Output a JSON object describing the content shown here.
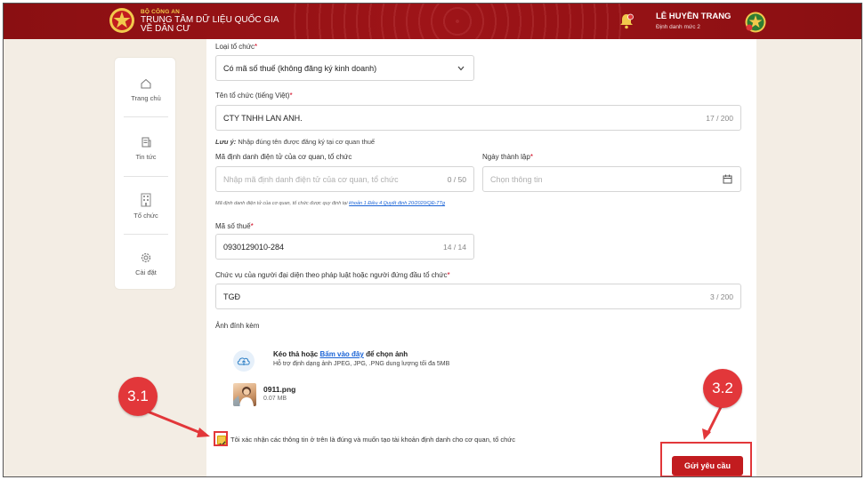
{
  "header": {
    "agency": "BỘ CÔNG AN",
    "center_line1": "TRUNG TÂM DỮ LIỆU QUỐC GIA",
    "center_line2": "VỀ DÂN CƯ",
    "user_name": "LÊ HUYỀN TRANG",
    "user_level": "Định danh mức 2"
  },
  "sidebar": {
    "items": [
      {
        "label": "Trang chủ",
        "icon": "home-icon"
      },
      {
        "label": "Tin tức",
        "icon": "news-icon"
      },
      {
        "label": "Tổ chức",
        "icon": "building-icon"
      },
      {
        "label": "Cài đặt",
        "icon": "gear-icon"
      }
    ]
  },
  "form": {
    "org_type_label": "Loại tổ chức",
    "org_type_value": "Có mã số thuế (không đăng ký kinh doanh)",
    "org_name_label": "Tên tổ chức (tiếng Việt)",
    "org_name_value": "CTY TNHH LAN ANH.",
    "org_name_count": "17 / 200",
    "note_prefix": "Lưu ý:",
    "note_text": "Nhập đúng tên được đăng ký tại cơ quan thuế",
    "eid_label": "Mã định danh điện tử của cơ quan, tổ chức",
    "eid_placeholder": "Nhập mã định danh điện tử của cơ quan, tổ chức",
    "eid_count": "0 / 50",
    "founded_label": "Ngày thành lập",
    "founded_placeholder": "Chọn thông tin",
    "eid_hint": "Mã định danh điện tử của cơ quan, tổ chức được quy định tại",
    "eid_hint_link": "khoản 1 Điều 4 Quyết định 20/2020/QĐ-TTg",
    "tax_label": "Mã số thuế",
    "tax_value": "0930129010-284",
    "tax_count": "14 / 14",
    "position_label": "Chức vụ của người đại diện theo pháp luật hoặc người đứng đầu tổ chức",
    "position_value": "TGĐ",
    "position_count": "3 / 200",
    "attach_label": "Ảnh đính kèm",
    "upload_prefix": "Kéo thả hoặc",
    "upload_link": "Bấm vào đây",
    "upload_suffix": "để chọn ảnh",
    "upload_sub": "Hỗ trợ định dạng ảnh JPEG, JPG, .PNG dung lượng tối đa 5MB",
    "file_name": "0911.png",
    "file_size": "0.07 MB",
    "confirm_text": "Tôi xác nhận các thông tin ở trên là đúng và muốn tạo tài khoản định danh cho cơ quan, tổ chức",
    "submit_label": "Gửi yêu cầu"
  },
  "annotations": {
    "callout1": "3.1",
    "callout2": "3.2",
    "color": "#e2373a"
  },
  "colors": {
    "header_bg": "#8a0f12",
    "accent": "#c21c1f",
    "checkbox": "#f2c94c",
    "link": "#1a63d6"
  }
}
